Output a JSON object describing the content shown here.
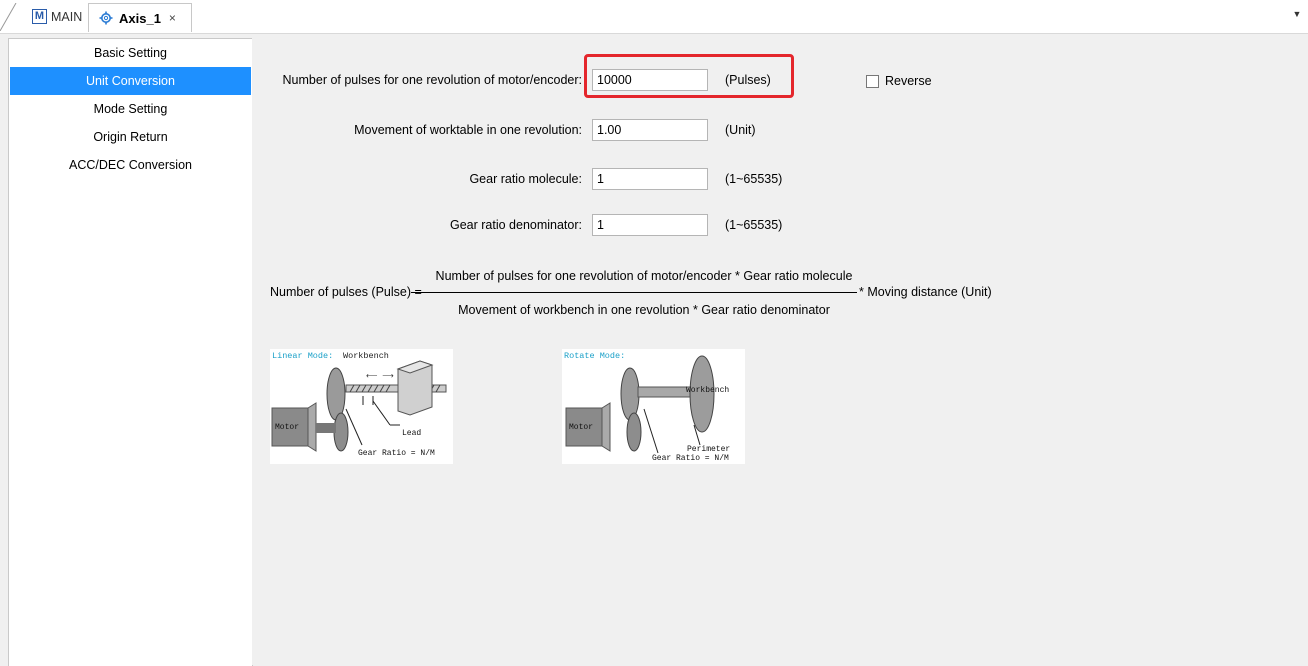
{
  "tabs": {
    "main_label": "MAIN",
    "main_icon": "m-icon",
    "axis_label": "Axis_1",
    "axis_icon": "gear-icon",
    "close_glyph": "×"
  },
  "sidebar": {
    "items": [
      {
        "label": "Basic Setting",
        "active": false
      },
      {
        "label": "Unit Conversion",
        "active": true
      },
      {
        "label": "Mode Setting",
        "active": false
      },
      {
        "label": "Origin Return",
        "active": false
      },
      {
        "label": "ACC/DEC Conversion",
        "active": false
      }
    ]
  },
  "form": {
    "pulses": {
      "label": "Number of pulses for one revolution of motor/encoder:",
      "value": "10000",
      "unit": "(Pulses)"
    },
    "movement": {
      "label": "Movement of worktable in one revolution:",
      "value": "1.00",
      "unit": "(Unit)"
    },
    "gear_molecule": {
      "label": "Gear ratio molecule:",
      "value": "1",
      "unit": "(1~65535)"
    },
    "gear_denominator": {
      "label": "Gear ratio denominator:",
      "value": "1",
      "unit": "(1~65535)"
    },
    "reverse_label": "Reverse"
  },
  "formula": {
    "left": "Number of pulses (Pulse) =",
    "numerator": "Number of pulses for one revolution of motor/encoder * Gear ratio molecule",
    "denominator": "Movement of workbench in one revolution *  Gear ratio denominator",
    "right": "*  Moving distance (Unit)"
  },
  "diagrams": {
    "linear": {
      "title": "Linear Mode:",
      "workbench": "Workbench",
      "motor": "Motor",
      "lead": "Lead",
      "gear_ratio": "Gear Ratio = N/M"
    },
    "rotate": {
      "title": "Rotate Mode:",
      "workbench": "Workbench",
      "motor": "Motor",
      "perimeter": "Perimeter",
      "gear_ratio": "Gear Ratio = N/M"
    }
  },
  "colors": {
    "accent": "#1e90ff",
    "highlight": "#e4262c",
    "diagram_title": "#1aa0c8"
  }
}
